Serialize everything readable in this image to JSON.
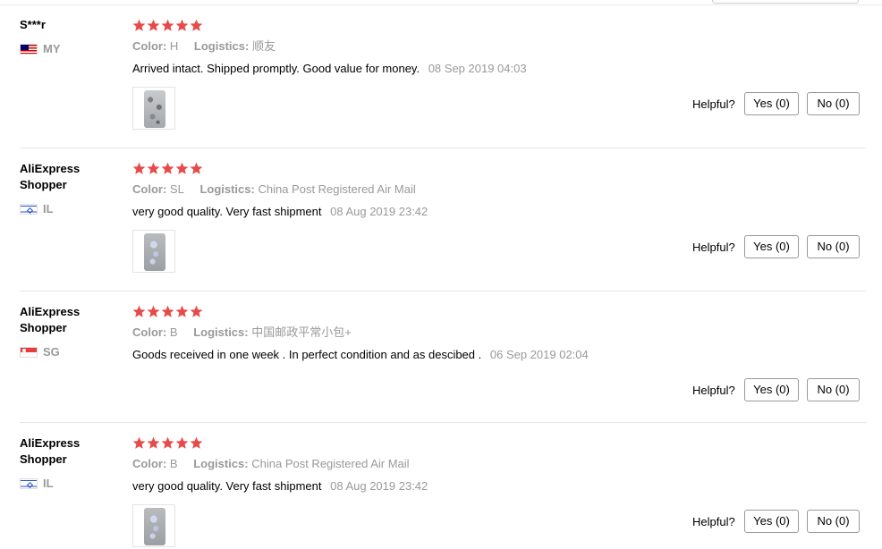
{
  "colors": {
    "star": "#e84a4a",
    "muted": "#999999",
    "text": "#000000",
    "divider": "#e6e6e6"
  },
  "labels": {
    "color_key": "Color:",
    "logistics_key": "Logistics:",
    "helpful": "Helpful?"
  },
  "reviews": [
    {
      "user": "S***r",
      "country": "MY",
      "rating": 5,
      "color": "H",
      "logistics": "顺友",
      "text": "Arrived intact. Shipped promptly. Good value for money.",
      "date": "08 Sep 2019 04:03",
      "has_photo": true,
      "yes_label": "Yes (0)",
      "no_label": "No (0)"
    },
    {
      "user": "AliExpress Shopper",
      "country": "IL",
      "rating": 5,
      "color": "SL",
      "logistics": "China Post Registered Air Mail",
      "text": "very good quality. Very fast shipment",
      "date": "08 Aug 2019 23:42",
      "has_photo": true,
      "yes_label": "Yes (0)",
      "no_label": "No (0)"
    },
    {
      "user": "AliExpress Shopper",
      "country": "SG",
      "rating": 5,
      "color": "B",
      "logistics": "中国邮政平常小包+",
      "text": "Goods received in one week . In perfect condition and as descibed .",
      "date": "06 Sep 2019 02:04",
      "has_photo": false,
      "yes_label": "Yes (0)",
      "no_label": "No (0)"
    },
    {
      "user": "AliExpress Shopper",
      "country": "IL",
      "rating": 5,
      "color": "B",
      "logistics": "China Post Registered Air Mail",
      "text": "very good quality. Very fast shipment",
      "date": "08 Aug 2019 23:42",
      "has_photo": true,
      "yes_label": "Yes (0)",
      "no_label": "No (0)"
    }
  ]
}
